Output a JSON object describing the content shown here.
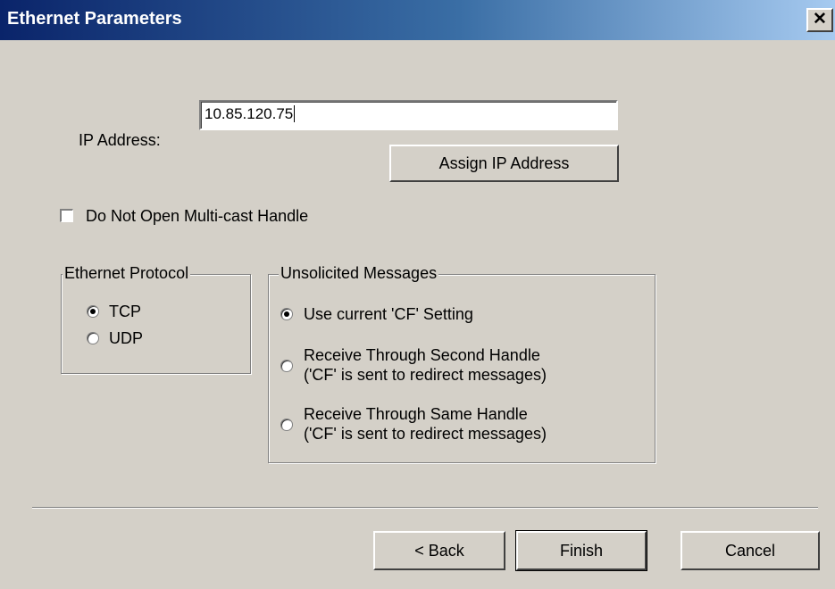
{
  "window": {
    "title": "Ethernet Parameters",
    "close_glyph": "✕"
  },
  "ip": {
    "label": "IP Address:",
    "value": "10.85.120.75",
    "assign_button": "Assign IP Address"
  },
  "multicast_checkbox": {
    "label": "Do Not Open Multi-cast Handle",
    "checked": false
  },
  "protocol": {
    "legend": "Ethernet Protocol",
    "options": [
      {
        "label": "TCP",
        "selected": true
      },
      {
        "label": "UDP",
        "selected": false
      }
    ]
  },
  "unsolicited": {
    "legend": "Unsolicited Messages",
    "options": [
      {
        "line1": "Use current 'CF' Setting",
        "line2": "",
        "selected": true
      },
      {
        "line1": "Receive Through Second Handle",
        "line2": "('CF' is sent to redirect messages)",
        "selected": false
      },
      {
        "line1": "Receive Through Same Handle",
        "line2": "('CF' is sent to redirect messages)",
        "selected": false
      }
    ]
  },
  "footer": {
    "back": "< Back",
    "finish": "Finish",
    "cancel": "Cancel"
  }
}
